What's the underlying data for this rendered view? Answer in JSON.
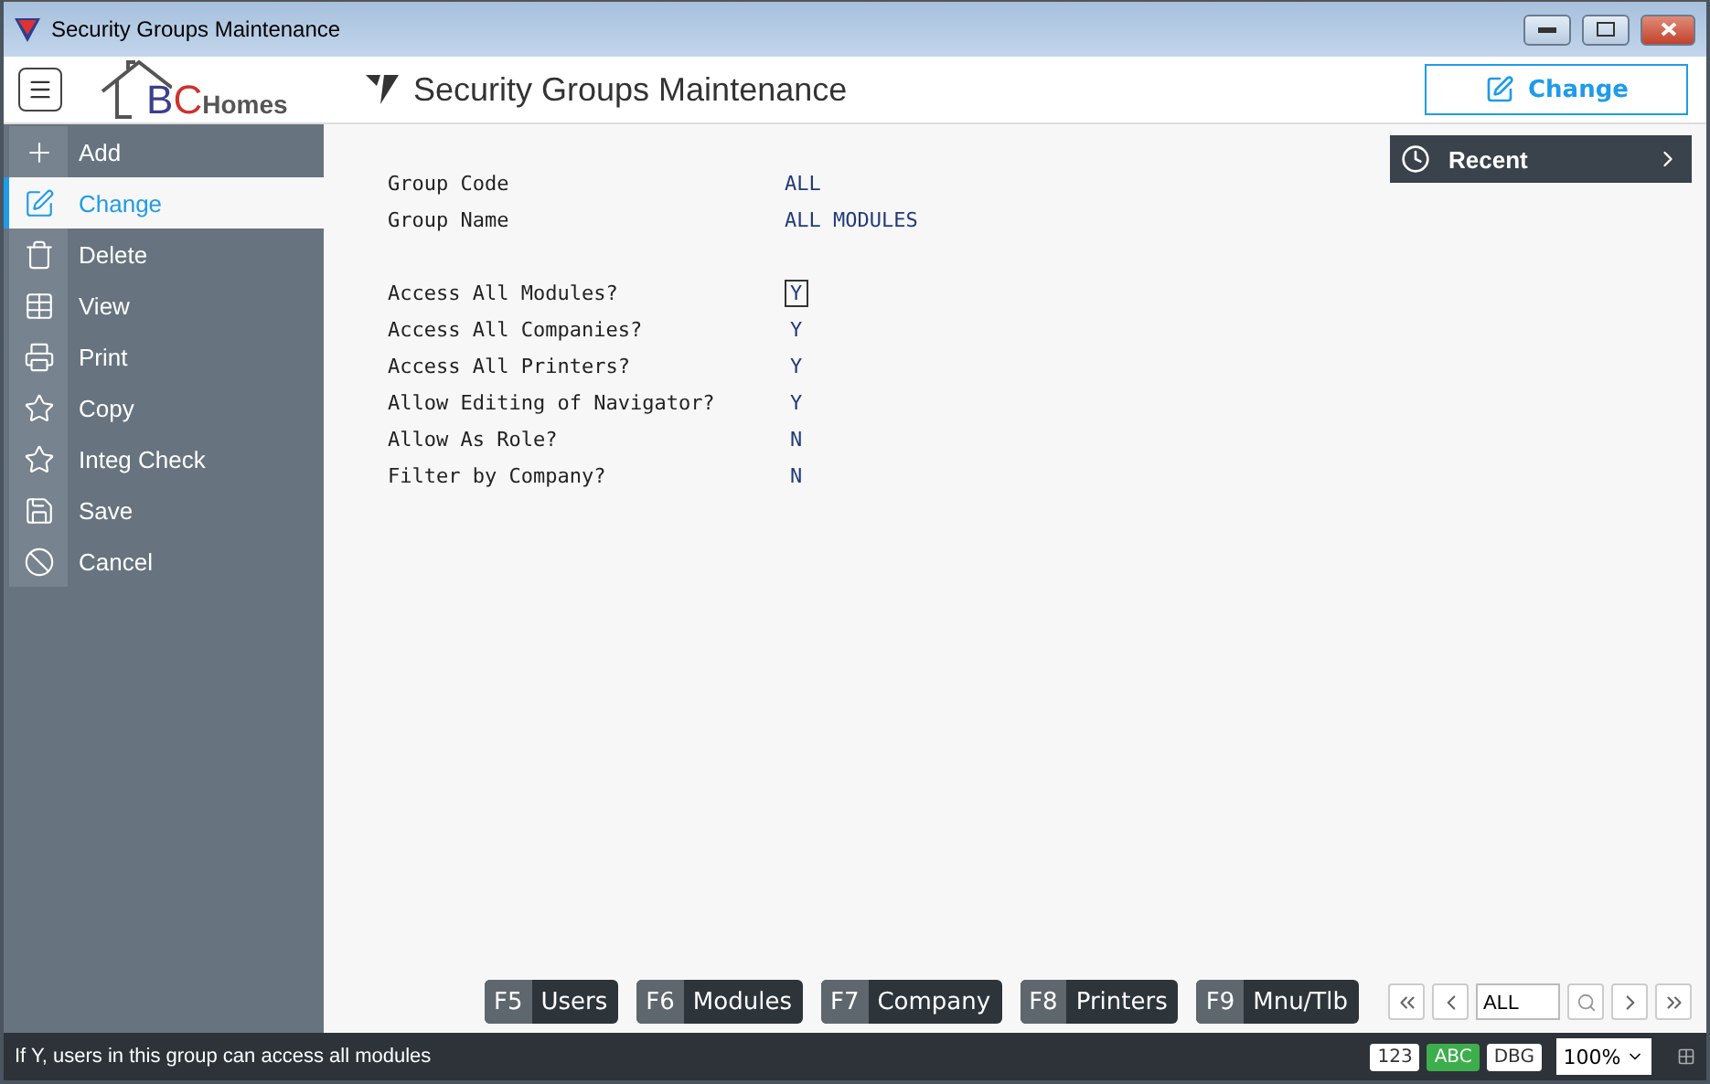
{
  "window": {
    "title": "Security Groups Maintenance"
  },
  "logo": {
    "initial_1": "B",
    "initial_2": "C",
    "word": "Homes"
  },
  "header": {
    "title": "Security Groups Maintenance",
    "action": "Change"
  },
  "sidebar": {
    "items": [
      {
        "label": "Add",
        "kind": "add",
        "selected": false
      },
      {
        "label": "Change",
        "kind": "change",
        "selected": true
      },
      {
        "label": "Delete",
        "kind": "delete",
        "selected": false
      },
      {
        "label": "View",
        "kind": "view",
        "selected": false
      },
      {
        "label": "Print",
        "kind": "print",
        "selected": false
      },
      {
        "label": "Copy",
        "kind": "star",
        "selected": false
      },
      {
        "label": "Integ Check",
        "kind": "star",
        "selected": false
      },
      {
        "label": "Save",
        "kind": "save",
        "selected": false
      },
      {
        "label": "Cancel",
        "kind": "cancel",
        "selected": false
      }
    ]
  },
  "recent": {
    "label": "Recent"
  },
  "header_fields": [
    {
      "label": "Group Code",
      "value": "ALL"
    },
    {
      "label": "Group Name",
      "value": "ALL MODULES"
    }
  ],
  "options": [
    {
      "label": "Access All Modules?",
      "value": "Y",
      "focused": true
    },
    {
      "label": "Access All Companies?",
      "value": "Y",
      "focused": false
    },
    {
      "label": "Access All Printers?",
      "value": "Y",
      "focused": false
    },
    {
      "label": "Allow Editing of Navigator?",
      "value": "Y",
      "focused": false
    },
    {
      "label": "Allow As Role?",
      "value": "N",
      "focused": false
    },
    {
      "label": "Filter by Company?",
      "value": "N",
      "focused": false
    }
  ],
  "function_keys": [
    {
      "key": "F5",
      "label": "Users"
    },
    {
      "key": "F6",
      "label": "Modules"
    },
    {
      "key": "F7",
      "label": "Company"
    },
    {
      "key": "F8",
      "label": "Printers"
    },
    {
      "key": "F9",
      "label": "Mnu/Tlb"
    }
  ],
  "navigator": {
    "search_value": "ALL"
  },
  "status_bar": {
    "message": "If Y, users in this group can access all modules",
    "modes": [
      {
        "label": "123",
        "selected": false
      },
      {
        "label": "ABC",
        "selected": true
      },
      {
        "label": "DBG",
        "selected": false
      }
    ],
    "zoom": "100%"
  }
}
